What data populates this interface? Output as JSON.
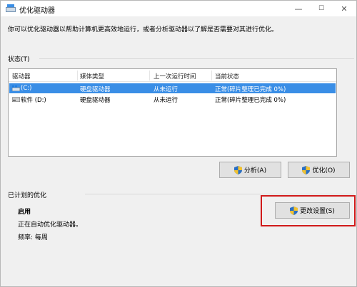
{
  "window": {
    "title": "优化驱动器",
    "min": "—",
    "max": "☐",
    "close": "✕"
  },
  "description": "你可以优化驱动器以帮助计算机更高效地运行，或者分析驱动器以了解是否需要对其进行优化。",
  "status": {
    "label": "状态(T)",
    "columns": [
      "驱动器",
      "媒体类型",
      "上一次运行时间",
      "当前状态"
    ],
    "drives": [
      {
        "name": "(C:)",
        "media": "硬盘驱动器",
        "last_run": "从未运行",
        "state": "正常(碎片整理已完成 0%)",
        "icon": "system-drive-icon",
        "selected": true
      },
      {
        "name": "软件 (D:)",
        "media": "硬盘驱动器",
        "last_run": "从未运行",
        "state": "正常(碎片整理已完成 0%)",
        "icon": "hard-drive-icon",
        "selected": false
      }
    ],
    "analyze_button": "分析(A)",
    "optimize_button": "优化(O)"
  },
  "scheduled": {
    "label": "已计划的优化",
    "state": "启用",
    "info": "正在自动优化驱动器。",
    "frequency": "频率: 每周",
    "change_button": "更改设置(S)"
  },
  "colors": {
    "selection": "#3a8ee6",
    "highlight": "#d11a1a",
    "shield_blue": "#2a6fc4",
    "shield_yellow": "#f2c230"
  }
}
